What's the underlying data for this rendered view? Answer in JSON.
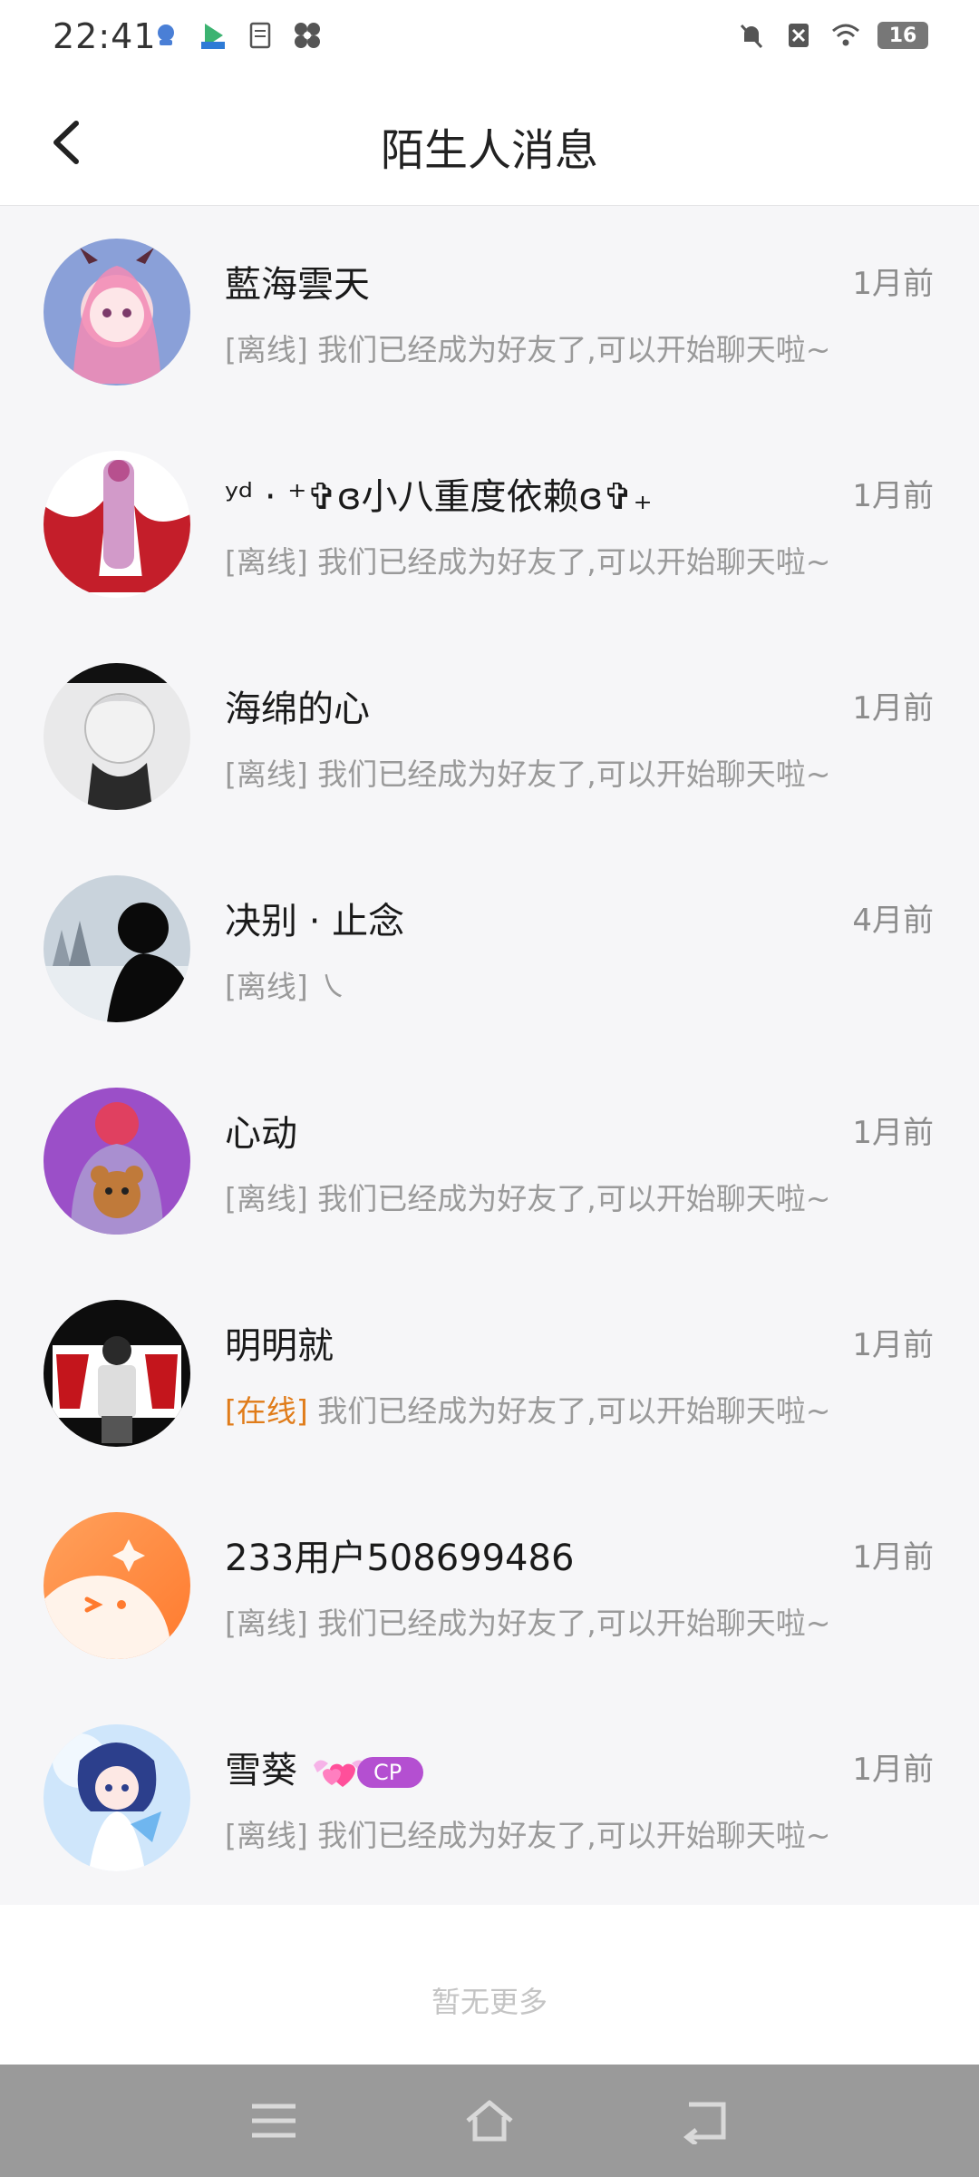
{
  "status_bar": {
    "time": "22:41",
    "battery": "16"
  },
  "header": {
    "title": "陌生人消息"
  },
  "conversations": [
    {
      "name": "藍海雲天",
      "time": "1月前",
      "status": "[离线]",
      "online": false,
      "message": "我们已经成为好友了,可以开始聊天啦~"
    },
    {
      "name": "ʸᵈ · ⁺✞ɞ小八重度依赖ɞ✞₊",
      "time": "1月前",
      "status": "[离线]",
      "online": false,
      "message": "我们已经成为好友了,可以开始聊天啦~"
    },
    {
      "name": "海绵的心",
      "time": "1月前",
      "status": "[离线]",
      "online": false,
      "message": "我们已经成为好友了,可以开始聊天啦~"
    },
    {
      "name": "决别 · 止念",
      "time": "4月前",
      "status": "[离线]",
      "online": false,
      "message": "㇏"
    },
    {
      "name": "心动",
      "time": "1月前",
      "status": "[离线]",
      "online": false,
      "message": "我们已经成为好友了,可以开始聊天啦~"
    },
    {
      "name": "明明就",
      "time": "1月前",
      "status": "[在线]",
      "online": true,
      "message": "我们已经成为好友了,可以开始聊天啦~"
    },
    {
      "name": "233用户508699486",
      "time": "1月前",
      "status": "[离线]",
      "online": false,
      "message": "我们已经成为好友了,可以开始聊天啦~"
    },
    {
      "name": "雪葵",
      "time": "1月前",
      "status": "[离线]",
      "online": false,
      "message": "我们已经成为好友了,可以开始聊天啦~",
      "badge": "CP"
    }
  ],
  "footer": {
    "no_more": "暂无更多"
  },
  "colors": {
    "online": "#e07c1a",
    "offline": "#9a9a9a",
    "cp_badge": "#b44fd1"
  }
}
